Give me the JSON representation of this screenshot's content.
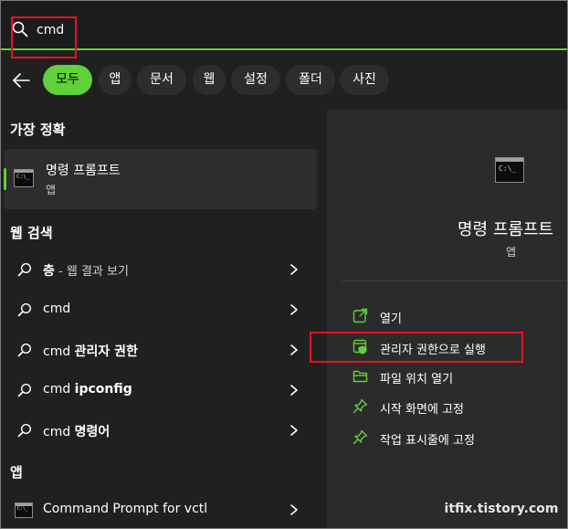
{
  "search": {
    "value": "cmd"
  },
  "filters": [
    {
      "label": "모두",
      "active": true
    },
    {
      "label": "앱"
    },
    {
      "label": "문서"
    },
    {
      "label": "웹"
    },
    {
      "label": "설정"
    },
    {
      "label": "폴더"
    },
    {
      "label": "사진"
    }
  ],
  "sections": {
    "best_match": "가장 정확",
    "web_search": "웹 검색",
    "apps": "앱"
  },
  "best_match": {
    "title": "명령 프롬프트",
    "subtitle": "앱",
    "icon_prompt": "C:\\_"
  },
  "web_results": [
    {
      "query": "층",
      "suffix": " - 웹 결과 보기"
    },
    {
      "query_prefix": "cmd",
      "query_bold": ""
    },
    {
      "query_prefix": "cmd ",
      "query_bold": "관리자 권한"
    },
    {
      "query_prefix": "cmd ",
      "query_bold": "ipconfig"
    },
    {
      "query_prefix": "cmd ",
      "query_bold": "명령어"
    }
  ],
  "app_results": [
    {
      "label": "Command Prompt for vctl"
    }
  ],
  "detail": {
    "title": "명령 프롬프트",
    "subtitle": "앱",
    "actions": [
      {
        "label": "열기",
        "icon": "open-icon"
      },
      {
        "label": "관리자 권한으로 실행",
        "icon": "shield-icon"
      },
      {
        "label": "파일 위치 열기",
        "icon": "folder-icon"
      },
      {
        "label": "시작 화면에 고정",
        "icon": "pin-icon"
      },
      {
        "label": "작업 표시줄에 고정",
        "icon": "pin-icon"
      }
    ]
  },
  "watermark": "itfix.tistory.com",
  "colors": {
    "accent": "#5fd13a",
    "highlight": "#e81123",
    "background": "#202020",
    "panel": "#2b2b2b"
  }
}
